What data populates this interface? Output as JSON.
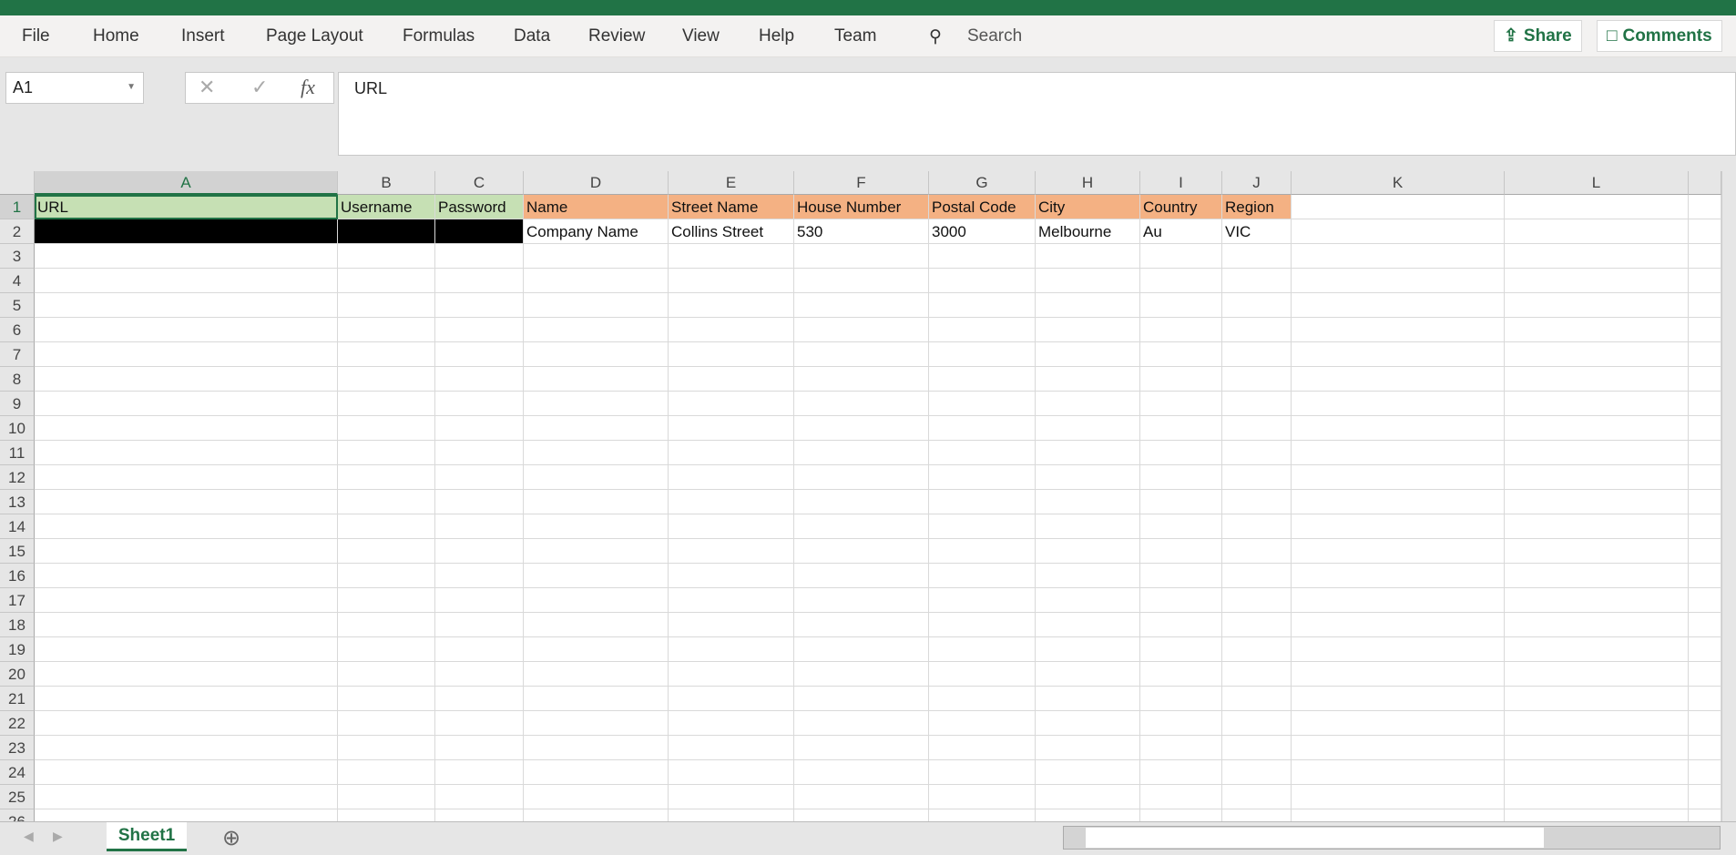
{
  "ribbon": {
    "tabs": [
      "File",
      "Home",
      "Insert",
      "Page Layout",
      "Formulas",
      "Data",
      "Review",
      "View",
      "Help",
      "Team"
    ],
    "search": "Search",
    "share": "Share",
    "comments": "Comments"
  },
  "formula_bar": {
    "name_box": "A1",
    "content": "URL",
    "cancel": "✕",
    "enter": "✓",
    "fx": "fx"
  },
  "columns": [
    "A",
    "B",
    "C",
    "D",
    "E",
    "F",
    "G",
    "H",
    "I",
    "J",
    "K",
    "L"
  ],
  "rows": [
    [
      "URL",
      "Username",
      "Password",
      "Name",
      "Street Name",
      "House Number",
      "Postal Code",
      "City",
      "Country",
      "Region",
      "",
      ""
    ],
    [
      "",
      "",
      "",
      "Company Name",
      "Collins Street",
      "530",
      "3000",
      "Melbourne",
      "Au",
      "VIC",
      "",
      ""
    ]
  ],
  "row_count": 26,
  "colors": {
    "green_header": "#c6e0b4",
    "orange_header": "#f4b183",
    "redacted": "#000000",
    "accent": "#217346"
  },
  "sheets": [
    "Sheet1"
  ]
}
